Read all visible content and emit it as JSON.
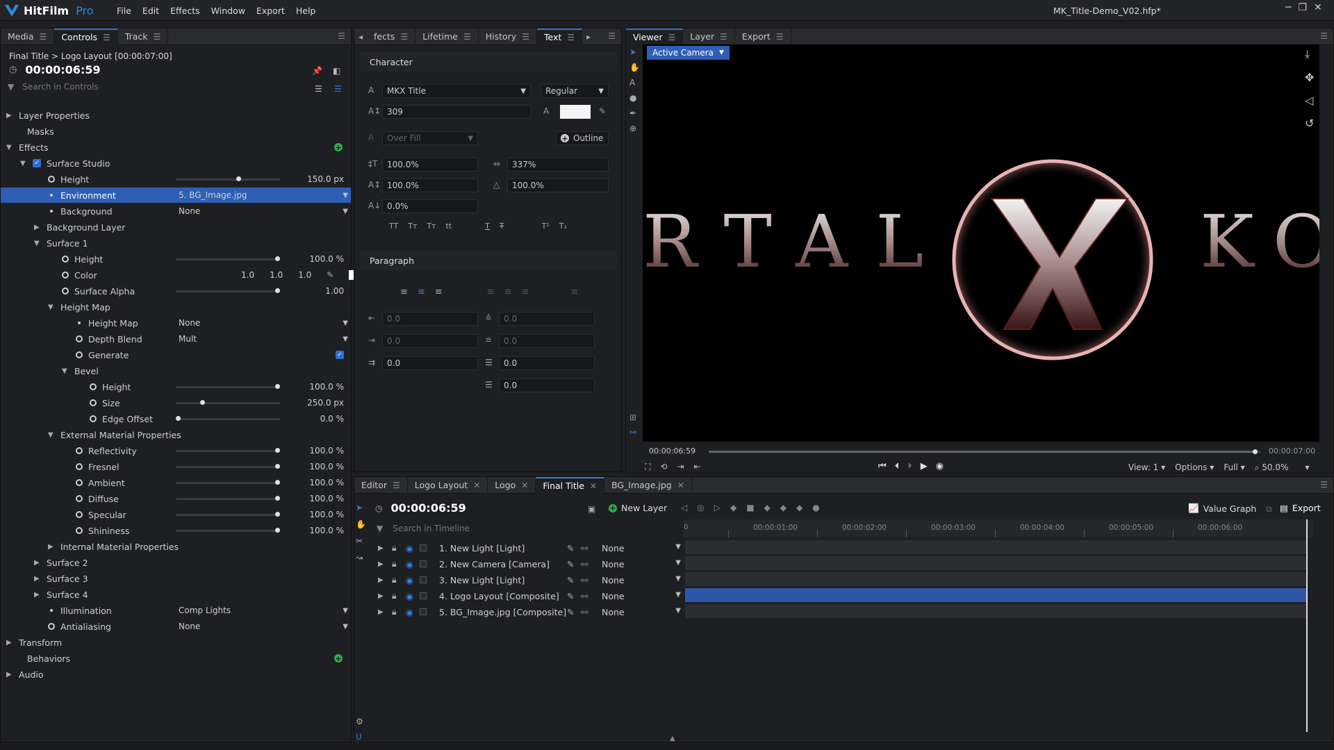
{
  "app": {
    "name": "HitFilm",
    "edition": "Pro",
    "project": "MK_Title-Demo_V02.hfp*"
  },
  "menu": [
    "File",
    "Edit",
    "Effects",
    "Window",
    "Export",
    "Help"
  ],
  "left_tabs": [
    "Media",
    "Controls",
    "Track"
  ],
  "controls": {
    "breadcrumb": "Final Title > Logo Layout [00:00:07:00]",
    "timecode": "00:00:06:59",
    "search_placeholder": "Search in Controls",
    "rows": {
      "layer_properties": "Layer Properties",
      "masks": "Masks",
      "effects": "Effects",
      "surface_studio": "Surface Studio",
      "height": {
        "label": "Height",
        "value": "150.0 px",
        "level": 0.6
      },
      "environment": {
        "label": "Environment",
        "value": "5. BG_Image.jpg"
      },
      "background": {
        "label": "Background",
        "value": "None"
      },
      "background_layer": "Background Layer",
      "surface1": "Surface 1",
      "s1_height": {
        "label": "Height",
        "value": "100.0 %",
        "level": 0.97
      },
      "s1_color": {
        "label": "Color",
        "r": "1.0",
        "g": "1.0",
        "b": "1.0"
      },
      "s1_alpha": {
        "label": "Surface Alpha",
        "value": "1.00",
        "level": 0.97
      },
      "height_map_group": "Height Map",
      "height_map": {
        "label": "Height Map",
        "value": "None"
      },
      "depth_blend": {
        "label": "Depth Blend",
        "value": "Mult"
      },
      "generate": {
        "label": "Generate"
      },
      "bevel": "Bevel",
      "b_height": {
        "label": "Height",
        "value": "100.0 %",
        "level": 0.97
      },
      "b_size": {
        "label": "Size",
        "value": "250.0 px",
        "level": 0.25
      },
      "b_edge": {
        "label": "Edge Offset",
        "value": "0.0 %",
        "level": 0.02
      },
      "ext_mat": "External Material Properties",
      "reflectivity": {
        "label": "Reflectivity",
        "value": "100.0 %",
        "level": 0.97
      },
      "fresnel": {
        "label": "Fresnel",
        "value": "100.0 %",
        "level": 0.97
      },
      "ambient": {
        "label": "Ambient",
        "value": "100.0 %",
        "level": 0.97
      },
      "diffuse": {
        "label": "Diffuse",
        "value": "100.0 %",
        "level": 0.97
      },
      "specular": {
        "label": "Specular",
        "value": "100.0 %",
        "level": 0.97
      },
      "shininess": {
        "label": "Shininess",
        "value": "100.0 %",
        "level": 0.97
      },
      "int_mat": "Internal Material Properties",
      "surface2": "Surface 2",
      "surface3": "Surface 3",
      "surface4": "Surface 4",
      "illumination": {
        "label": "Illumination",
        "value": "Comp Lights"
      },
      "antialiasing": {
        "label": "Antialiasing",
        "value": "None"
      },
      "transform": "Transform",
      "behaviors": "Behaviors",
      "audio": "Audio"
    }
  },
  "mid_tabs": [
    "fects",
    "Lifetime",
    "History",
    "Text"
  ],
  "text": {
    "character": "Character",
    "font": "MKX Title",
    "style": "Regular",
    "size": "309",
    "fill": "Over Fill",
    "outline": "Outline",
    "vscale": "100.0%",
    "tracking": "337%",
    "hscale": "100.0%",
    "opacity": "100.0%",
    "baseline": "0.0%",
    "caps": [
      "TT",
      "Tт",
      "Tт",
      "tt"
    ],
    "underline": "T",
    "strike": "T",
    "super": "T¹",
    "sub": "T₁",
    "paragraph": "Paragraph",
    "p_left": "0.0",
    "p_right": "0.0",
    "p_first": "0.0",
    "p_before": "0.0",
    "p_after": "0.0",
    "p_after2": "0.0",
    "p_after3": "0.0"
  },
  "viewer_tabs": [
    "Viewer",
    "Layer",
    "Export"
  ],
  "viewer": {
    "camera": "Active Camera",
    "title_left": "RTAL",
    "title_right": "KO",
    "time": "00:00:06:59",
    "end": "00:00:07:00",
    "view": "View: 1",
    "options": "Options",
    "quality": "Full",
    "zoom": "50.0%",
    "progress": 0.99
  },
  "editor_tabs": [
    "Editor",
    "Logo Layout",
    "Logo",
    "Final Title",
    "BG_Image.jpg"
  ],
  "editor": {
    "timecode": "00:00:06:59",
    "new_layer": "New Layer",
    "value_graph": "Value Graph",
    "export": "Export",
    "search_placeholder": "Search in Timeline",
    "ruler": [
      "00:00:01:00",
      "00:00:02:00",
      "00:00:03:00",
      "00:00:04:00",
      "00:00:05:00",
      "00:00:06:00"
    ],
    "ruler_start": "0",
    "layers": [
      {
        "name": "1. New Light [Light]",
        "blend": "None"
      },
      {
        "name": "2. New Camera [Camera]",
        "blend": "None"
      },
      {
        "name": "3. New Light [Light]",
        "blend": "None"
      },
      {
        "name": "4. Logo Layout [Composite]",
        "blend": "None"
      },
      {
        "name": "5. BG_Image.jpg [Composite]",
        "blend": "None"
      }
    ]
  },
  "colors": {
    "accent": "#2f5fb5",
    "green": "#2bb04a",
    "brand": "#2e8bdc"
  }
}
